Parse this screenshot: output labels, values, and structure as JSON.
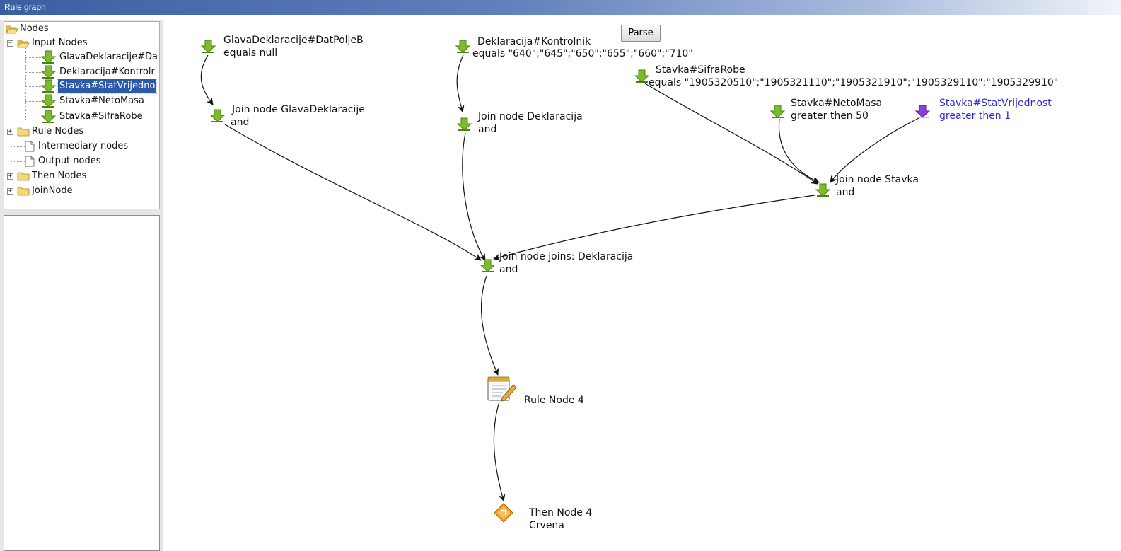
{
  "window": {
    "title": "Rule graph"
  },
  "toolbar": {
    "parse_label": "Parse"
  },
  "tree": {
    "root": "Nodes",
    "input_nodes": "Input Nodes",
    "input_items": [
      "GlavaDeklaracije#Da",
      "Deklaracija#Kontrolr",
      "Stavka#StatVrijedno",
      "Stavka#NetoMasa",
      "Stavka#SifraRobe"
    ],
    "selected_index": 2,
    "rule_nodes": "Rule Nodes",
    "intermediary_nodes": "Intermediary nodes",
    "output_nodes": "Output nodes",
    "then_nodes": "Then Nodes",
    "join_node": "JoinNode"
  },
  "graph": {
    "nodes": {
      "glava": {
        "line1": "GlavaDeklaracije#DatPoljeB",
        "line2": "equals null"
      },
      "kontrolnik": {
        "line1": "Deklaracija#Kontrolnik",
        "line2": "equals \"640\";\"645\";\"650\";\"655\";\"660\";\"710\""
      },
      "sifra": {
        "line1": "Stavka#SifraRobe",
        "line2": "equals \"1905320510\";\"1905321110\";\"1905321910\";\"1905329110\";\"1905329910\""
      },
      "neto": {
        "line1": "Stavka#NetoMasa",
        "line2": "greater then 50"
      },
      "stat": {
        "line1": "Stavka#StatVrijednost",
        "line2": "greater then 1"
      },
      "join_glava": {
        "line1": "Join node GlavaDeklaracije",
        "line2": "and"
      },
      "join_dekl": {
        "line1": "Join node Deklaracija",
        "line2": "and"
      },
      "join_stavka": {
        "line1": "Join node Stavka",
        "line2": "and"
      },
      "join_joins": {
        "line1": "Join node joins: Deklaracija",
        "line2": "and"
      },
      "rule4": {
        "line1": "Rule Node 4"
      },
      "then4": {
        "line1": "Then Node 4",
        "line2": "Crvena"
      }
    }
  },
  "colors": {
    "input_arrow": "#7dbb2e",
    "selected_arrow": "#8a3fd6",
    "highlight_text": "#2b2bd6",
    "then_icon": "#f0a020"
  }
}
